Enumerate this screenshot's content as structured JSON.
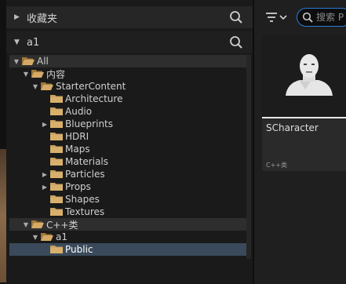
{
  "favorites": {
    "label": "收藏夹",
    "expanded": false
  },
  "project": {
    "label": "a1",
    "expanded": true
  },
  "tree": [
    {
      "label": "All",
      "expanded": true,
      "has_children": true
    },
    {
      "label": "内容",
      "expanded": true,
      "has_children": true
    },
    {
      "label": "StarterContent",
      "expanded": true,
      "has_children": true
    },
    {
      "label": "Architecture",
      "has_children": false
    },
    {
      "label": "Audio",
      "has_children": false
    },
    {
      "label": "Blueprints",
      "expanded": false,
      "has_children": true
    },
    {
      "label": "HDRI",
      "has_children": false
    },
    {
      "label": "Maps",
      "has_children": false
    },
    {
      "label": "Materials",
      "has_children": false
    },
    {
      "label": "Particles",
      "expanded": false,
      "has_children": true
    },
    {
      "label": "Props",
      "expanded": false,
      "has_children": true
    },
    {
      "label": "Shapes",
      "has_children": false
    },
    {
      "label": "Textures",
      "has_children": false
    },
    {
      "label": "C++类",
      "expanded": true,
      "has_children": true
    },
    {
      "label": "a1",
      "expanded": true,
      "has_children": true
    },
    {
      "label": "Public",
      "has_children": false,
      "selected": true
    }
  ],
  "content_search": {
    "placeholder": "搜索 P"
  },
  "asset": {
    "name": "SCharacter",
    "type": "C++类"
  },
  "colors": {
    "folder": "#c8a060",
    "selection": "#3a4a5a",
    "accent": "#2a7fd6"
  }
}
